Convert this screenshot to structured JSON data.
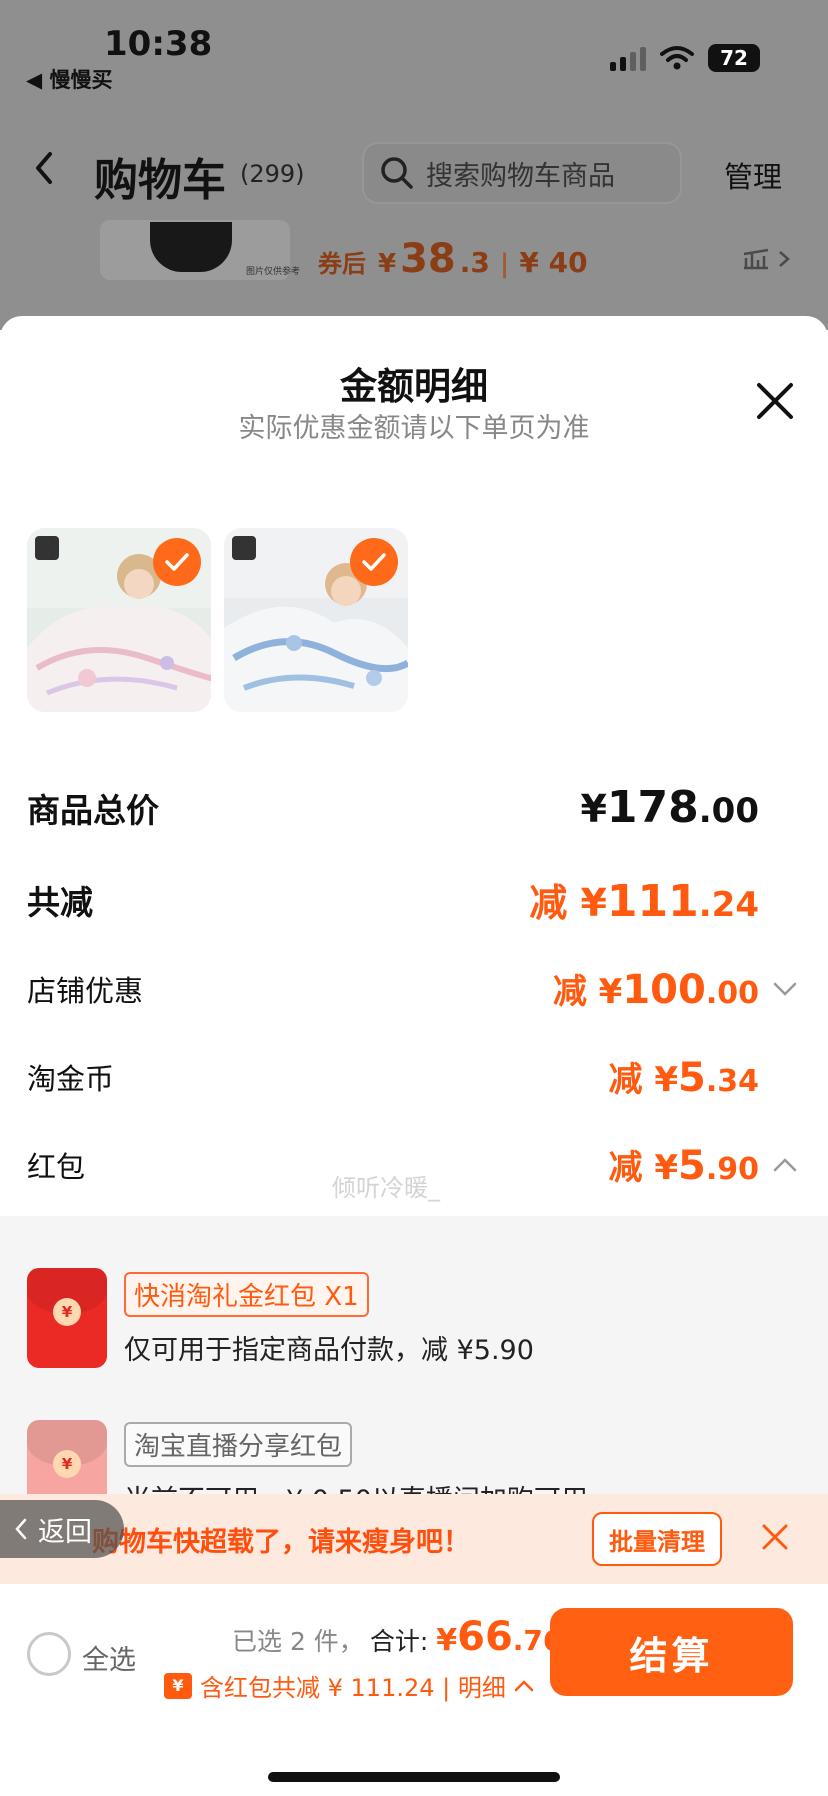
{
  "status_bar": {
    "time": "10:38",
    "back_app": "◀ 慢慢买",
    "battery": "72"
  },
  "nav": {
    "title": "购物车",
    "count": "(299)",
    "search_placeholder": "搜索购物车商品",
    "manage": "管理"
  },
  "background_product": {
    "image_note": "图片仅供参考",
    "after_coupon_label": "券后",
    "price_currency": "¥",
    "price_int": "38",
    "price_dec": ".3",
    "original_price": "¥ 40"
  },
  "sheet": {
    "title": "金额明细",
    "subtitle": "实际优惠金额请以下单页为准",
    "rows": {
      "total": {
        "label": "商品总价",
        "prefix": "¥",
        "int": "178",
        "dec": ".00"
      },
      "reduction": {
        "label": "共减",
        "prefix": "减 ¥",
        "int": "111",
        "dec": ".24"
      },
      "shop": {
        "label": "店铺优惠",
        "prefix": "减 ¥",
        "int": "100",
        "dec": ".00"
      },
      "coins": {
        "label": "淘金币",
        "prefix": "减 ¥",
        "int": "5",
        "dec": ".34"
      },
      "redpacket": {
        "label": "红包",
        "prefix": "减 ¥",
        "int": "5",
        "dec": ".90"
      }
    },
    "watermark": "倾听冷暖_",
    "redpackets": [
      {
        "tag": "快消淘礼金红包 X1",
        "desc": "仅可用于指定商品付款，减 ¥5.90"
      },
      {
        "tag": "淘宝直播分享红包",
        "desc": "当前不可用，¥ 0.50以直播间加购可用"
      }
    ],
    "coin_glyph": "¥"
  },
  "banner": {
    "text": "购物车快超载了，请来瘦身吧！",
    "button": "批量清理",
    "return": "返回"
  },
  "bottom": {
    "select_all": "全选",
    "selected": "已选 2 件，",
    "total_label": "合计:",
    "price_currency": "¥ ",
    "price_int": "66",
    "price_dec": ".76",
    "discount_badge": "¥",
    "discount_text": "含红包共减 ¥ 111.24 | 明细",
    "checkout": "结算"
  },
  "colors": {
    "accent": "#ff5a0f",
    "checkout": "#ff6012",
    "banner_bg": "#fde9de",
    "redpacket": "#ec2a25"
  }
}
